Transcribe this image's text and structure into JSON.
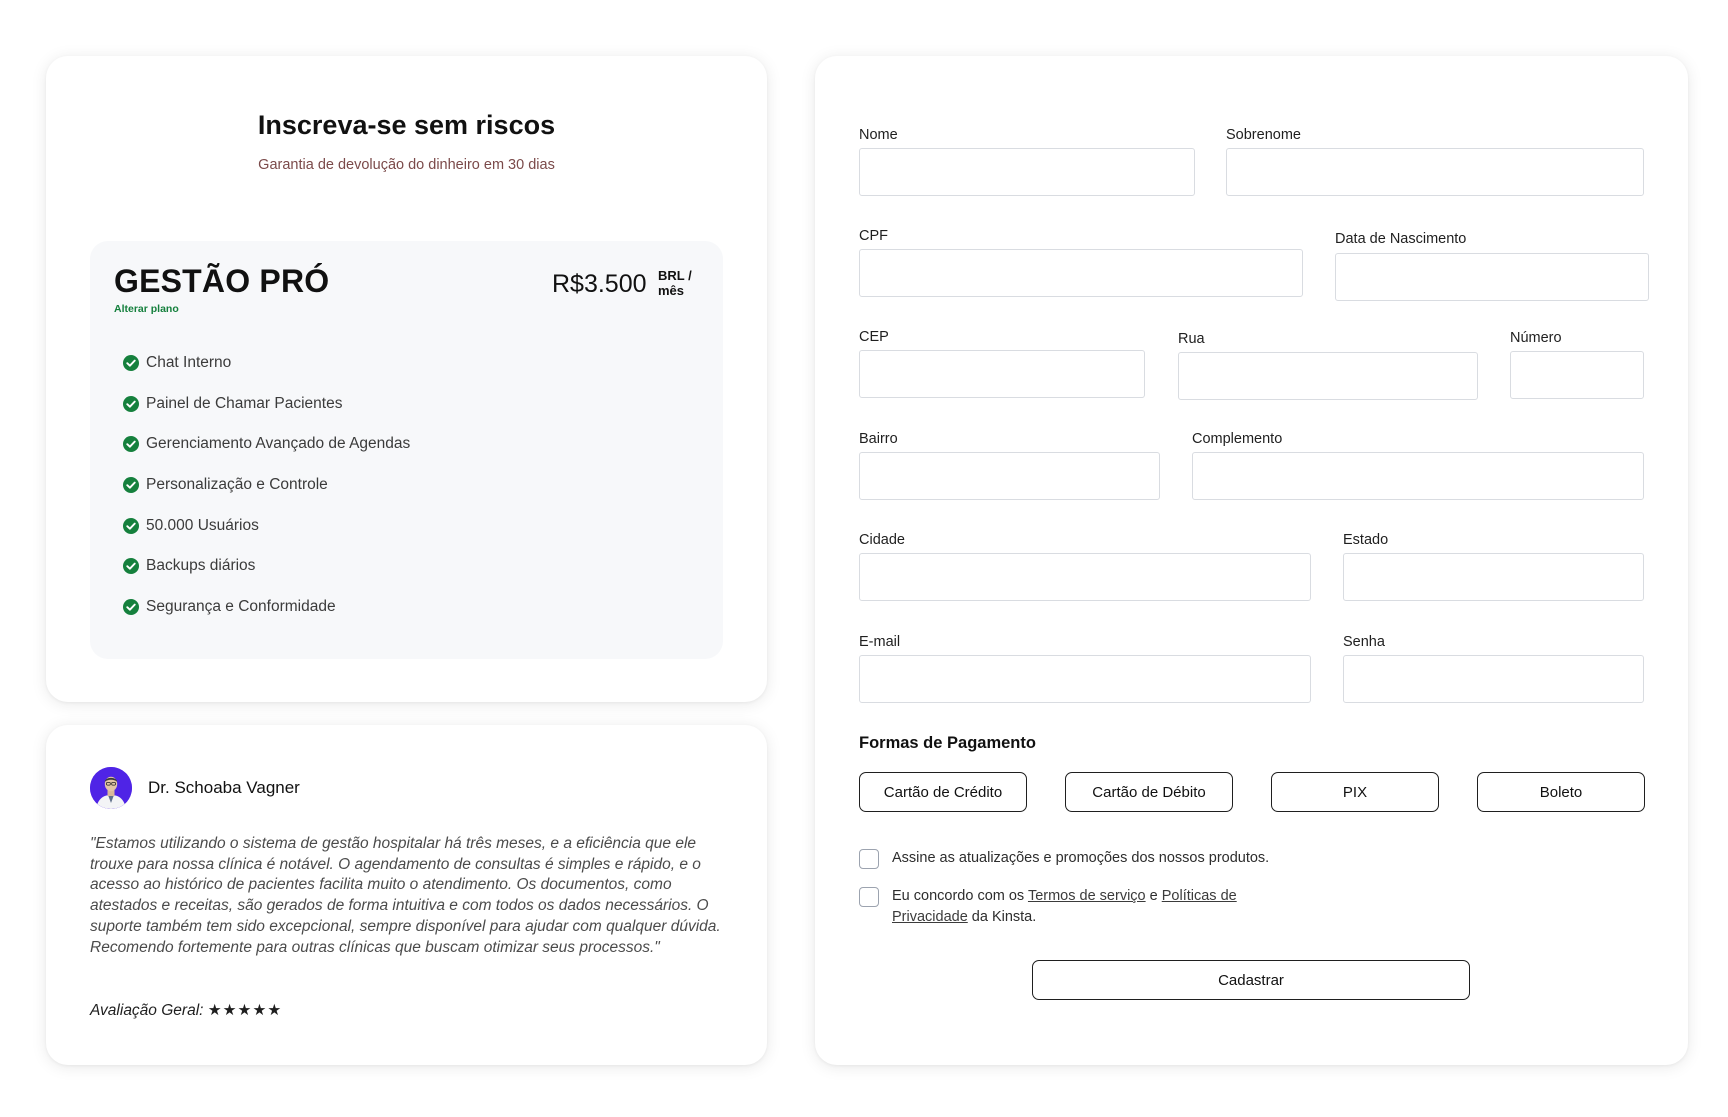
{
  "plan": {
    "title": "Inscreva-se sem riscos",
    "subtitle": "Garantia de devolução do dinheiro em 30 dias",
    "name": "GESTÃO PRÓ",
    "change_label": "Alterar plano",
    "price": "R$3.500",
    "period": "BRL / mês",
    "features": [
      "Chat Interno",
      "Painel de Chamar Pacientes",
      "Gerenciamento Avançado de Agendas",
      "Personalização e Controle",
      "50.000 Usuários",
      "Backups diários",
      "Segurança e Conformidade"
    ],
    "check_color": "#15803d"
  },
  "testimonial": {
    "name": "Dr. Schoaba Vagner",
    "quote": "\"Estamos utilizando o sistema de gestão hospitalar há três meses, e a eficiência que ele trouxe para nossa clínica é notável. O agendamento de consultas é simples e rápido, e o acesso ao histórico de pacientes facilita muito o atendimento. Os documentos, como atestados e receitas, são gerados de forma intuitiva e com todos os dados necessários. O suporte também tem sido excepcional, sempre disponível para ajudar com qualquer dúvida. Recomendo fortemente para outras clínicas que buscam otimizar seus processos.\"",
    "rating_label": "Avaliação Geral:",
    "stars": "★★★★★",
    "rating": 5
  },
  "form": {
    "labels": {
      "nome": "Nome",
      "sobrenome": "Sobrenome",
      "cpf": "CPF",
      "nascimento": "Data de Nascimento",
      "cep": "CEP",
      "rua": "Rua",
      "numero": "Número",
      "bairro": "Bairro",
      "complemento": "Complemento",
      "cidade": "Cidade",
      "estado": "Estado",
      "email": "E-mail",
      "senha": "Senha"
    },
    "values": {
      "nome": "",
      "sobrenome": "",
      "cpf": "",
      "nascimento": "",
      "cep": "",
      "rua": "",
      "numero": "",
      "bairro": "",
      "complemento": "",
      "cidade": "",
      "estado": "",
      "email": "",
      "senha": ""
    },
    "payment_title": "Formas de Pagamento",
    "payment_options": [
      "Cartão de Crédito",
      "Cartão de Débito",
      "PIX",
      "Boleto"
    ],
    "newsletter_label": "Assine as atualizações e promoções dos nossos produtos.",
    "terms": {
      "prefix": "Eu concordo com os ",
      "terms_link": "Termos de serviço",
      "middle": " e ",
      "privacy_link": "Políticas de Privacidade",
      "suffix": " da Kinsta."
    },
    "submit_label": "Cadastrar"
  }
}
